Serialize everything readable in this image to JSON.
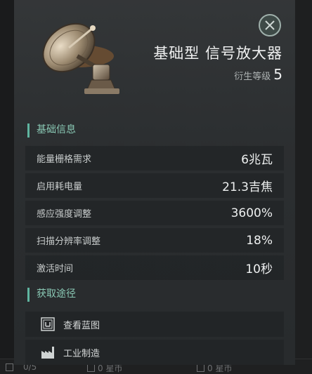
{
  "item": {
    "title": "基础型 信号放大器",
    "level_label": "衍生等级",
    "level_value": "5"
  },
  "basic_info": {
    "heading": "基础信息",
    "rows": [
      {
        "label": "能量栅格需求",
        "value": "6兆瓦"
      },
      {
        "label": "启用耗电量",
        "value": "21.3吉焦"
      },
      {
        "label": "感应强度调整",
        "value": "3600%"
      },
      {
        "label": "扫描分辨率调整",
        "value": "18%"
      },
      {
        "label": "激活时间",
        "value": "10秒"
      }
    ]
  },
  "acquisition": {
    "heading": "获取途径",
    "items": [
      {
        "label": "查看蓝图",
        "icon": "blueprint-icon"
      },
      {
        "label": "工业制造",
        "icon": "factory-icon"
      }
    ]
  },
  "background_bar": {
    "count": "0/5",
    "price_a": "0 星币",
    "price_b": "0 星币"
  },
  "colors": {
    "accent": "#5fb5a0",
    "panel": "#2f3234",
    "text": "#eef0f0"
  }
}
